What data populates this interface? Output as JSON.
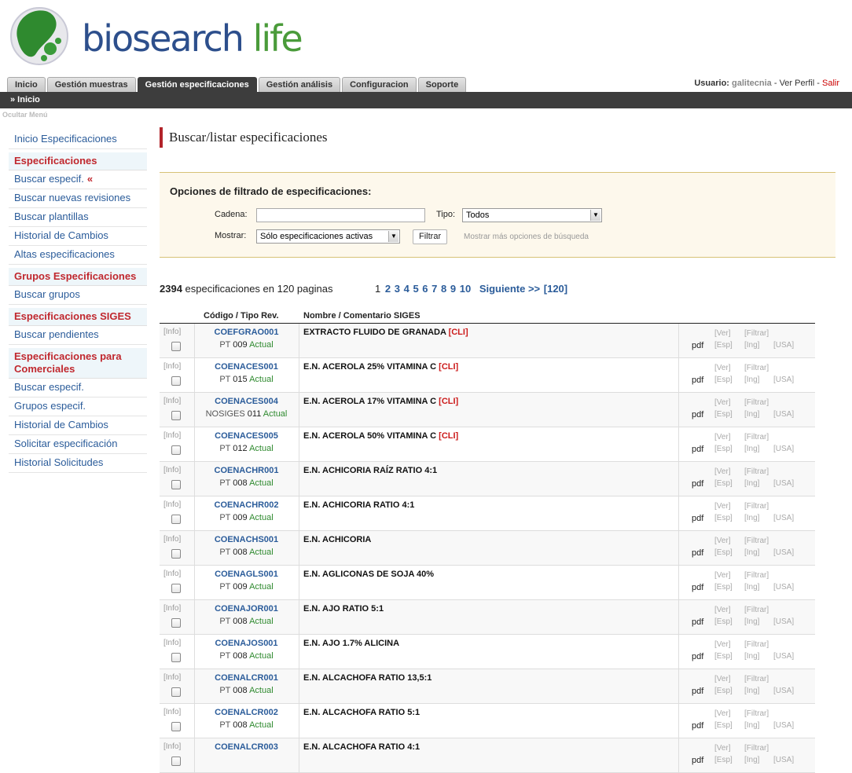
{
  "colors": {
    "brand_blue": "#2d4f8c",
    "brand_green": "#4a9b3a",
    "accent_red": "#c0282e",
    "link_blue": "#2b5c9a",
    "dark_bar": "#3d3d3d"
  },
  "logo": {
    "word1": "biosearch",
    "word2": "life"
  },
  "tabs": [
    {
      "label": "Inicio",
      "active": false
    },
    {
      "label": "Gestión muestras",
      "active": false
    },
    {
      "label": "Gestión especificaciones",
      "active": true
    },
    {
      "label": "Gestión análisis",
      "active": false
    },
    {
      "label": "Configuracion",
      "active": false
    },
    {
      "label": "Soporte",
      "active": false
    }
  ],
  "user": {
    "label": "Usuario:",
    "name": "galitecnia",
    "sep1": " - ",
    "profile": "Ver Perfil",
    "sep2": " - ",
    "logout": "Salir"
  },
  "breadcrumb": "» Inicio",
  "hide_menu": "Ocultar Menú",
  "sidebar": {
    "top_link": "Inicio Especificaciones",
    "sections": [
      {
        "title": "Especificaciones",
        "items": [
          "Buscar especif.",
          "Buscar nuevas revisiones",
          "Buscar plantillas",
          "Historial de Cambios",
          "Altas especificaciones"
        ]
      },
      {
        "title": "Grupos Especificaciones",
        "items": [
          "Buscar grupos"
        ]
      },
      {
        "title": "Especificaciones SIGES",
        "items": [
          "Buscar pendientes"
        ]
      },
      {
        "title": "Especificaciones para Comerciales",
        "items": [
          "Buscar especif.",
          "Grupos especif.",
          "Historial de Cambios",
          "Solicitar especificación",
          "Historial Solicitudes"
        ]
      }
    ],
    "current_marker": "«"
  },
  "main": {
    "title": "Buscar/listar especificaciones",
    "filter": {
      "title": "Opciones de filtrado de especificaciones:",
      "cadena_label": "Cadena:",
      "cadena_value": "",
      "tipo_label": "Tipo:",
      "tipo_value": "Todos",
      "mostrar_label": "Mostrar:",
      "mostrar_value": "Sólo especificaciones activas",
      "filter_button": "Filtrar",
      "more_options": "Mostrar más opciones de búsqueda"
    },
    "summary": {
      "count": "2394",
      "text": " especificaciones en 120 paginas"
    },
    "pager": {
      "current": "1",
      "pages": [
        "2",
        "3",
        "4",
        "5",
        "6",
        "7",
        "8",
        "9",
        "10"
      ],
      "next": "Siguiente >>",
      "last": "[120]"
    },
    "table": {
      "headers": {
        "code": "Código / Tipo Rev.",
        "name": "Nombre / Comentario SIGES"
      },
      "labels": {
        "info": "[Info]",
        "pdf": "pdf",
        "ver": "[Ver]",
        "filtrar": "[Filtrar]",
        "esp": "[Esp]",
        "ing": "[Ing]",
        "usa": "[USA]"
      },
      "rows": [
        {
          "code": "COEFGRAO001",
          "type": "PT",
          "rev": "009",
          "status": "Actual",
          "name": "EXTRACTO FLUIDO DE GRANADA",
          "tag": "[CLI]"
        },
        {
          "code": "COENACES001",
          "type": "PT",
          "rev": "015",
          "status": "Actual",
          "name": "E.N. ACEROLA 25% VITAMINA C",
          "tag": "[CLI]"
        },
        {
          "code": "COENACES004",
          "type": "NOSIGES",
          "rev": "011",
          "status": "Actual",
          "name": "E.N. ACEROLA 17% VITAMINA C",
          "tag": "[CLI]"
        },
        {
          "code": "COENACES005",
          "type": "PT",
          "rev": "012",
          "status": "Actual",
          "name": "E.N. ACEROLA 50% VITAMINA C",
          "tag": "[CLI]"
        },
        {
          "code": "COENACHR001",
          "type": "PT",
          "rev": "008",
          "status": "Actual",
          "name": "E.N. ACHICORIA RAÍZ RATIO 4:1",
          "tag": ""
        },
        {
          "code": "COENACHR002",
          "type": "PT",
          "rev": "009",
          "status": "Actual",
          "name": "E.N. ACHICORIA RATIO 4:1",
          "tag": ""
        },
        {
          "code": "COENACHS001",
          "type": "PT",
          "rev": "008",
          "status": "Actual",
          "name": "E.N. ACHICORIA",
          "tag": ""
        },
        {
          "code": "COENAGLS001",
          "type": "PT",
          "rev": "009",
          "status": "Actual",
          "name": "E.N. AGLICONAS DE SOJA 40%",
          "tag": ""
        },
        {
          "code": "COENAJOR001",
          "type": "PT",
          "rev": "008",
          "status": "Actual",
          "name": "E.N. AJO RATIO 5:1",
          "tag": ""
        },
        {
          "code": "COENAJOS001",
          "type": "PT",
          "rev": "008",
          "status": "Actual",
          "name": "E.N. AJO 1.7% ALICINA",
          "tag": ""
        },
        {
          "code": "COENALCR001",
          "type": "PT",
          "rev": "008",
          "status": "Actual",
          "name": "E.N. ALCACHOFA RATIO 13,5:1",
          "tag": ""
        },
        {
          "code": "COENALCR002",
          "type": "PT",
          "rev": "008",
          "status": "Actual",
          "name": "E.N. ALCACHOFA RATIO 5:1",
          "tag": ""
        },
        {
          "code": "COENALCR003",
          "type": "",
          "rev": "",
          "status": "",
          "name": "E.N. ALCACHOFA RATIO 4:1",
          "tag": ""
        }
      ]
    }
  }
}
